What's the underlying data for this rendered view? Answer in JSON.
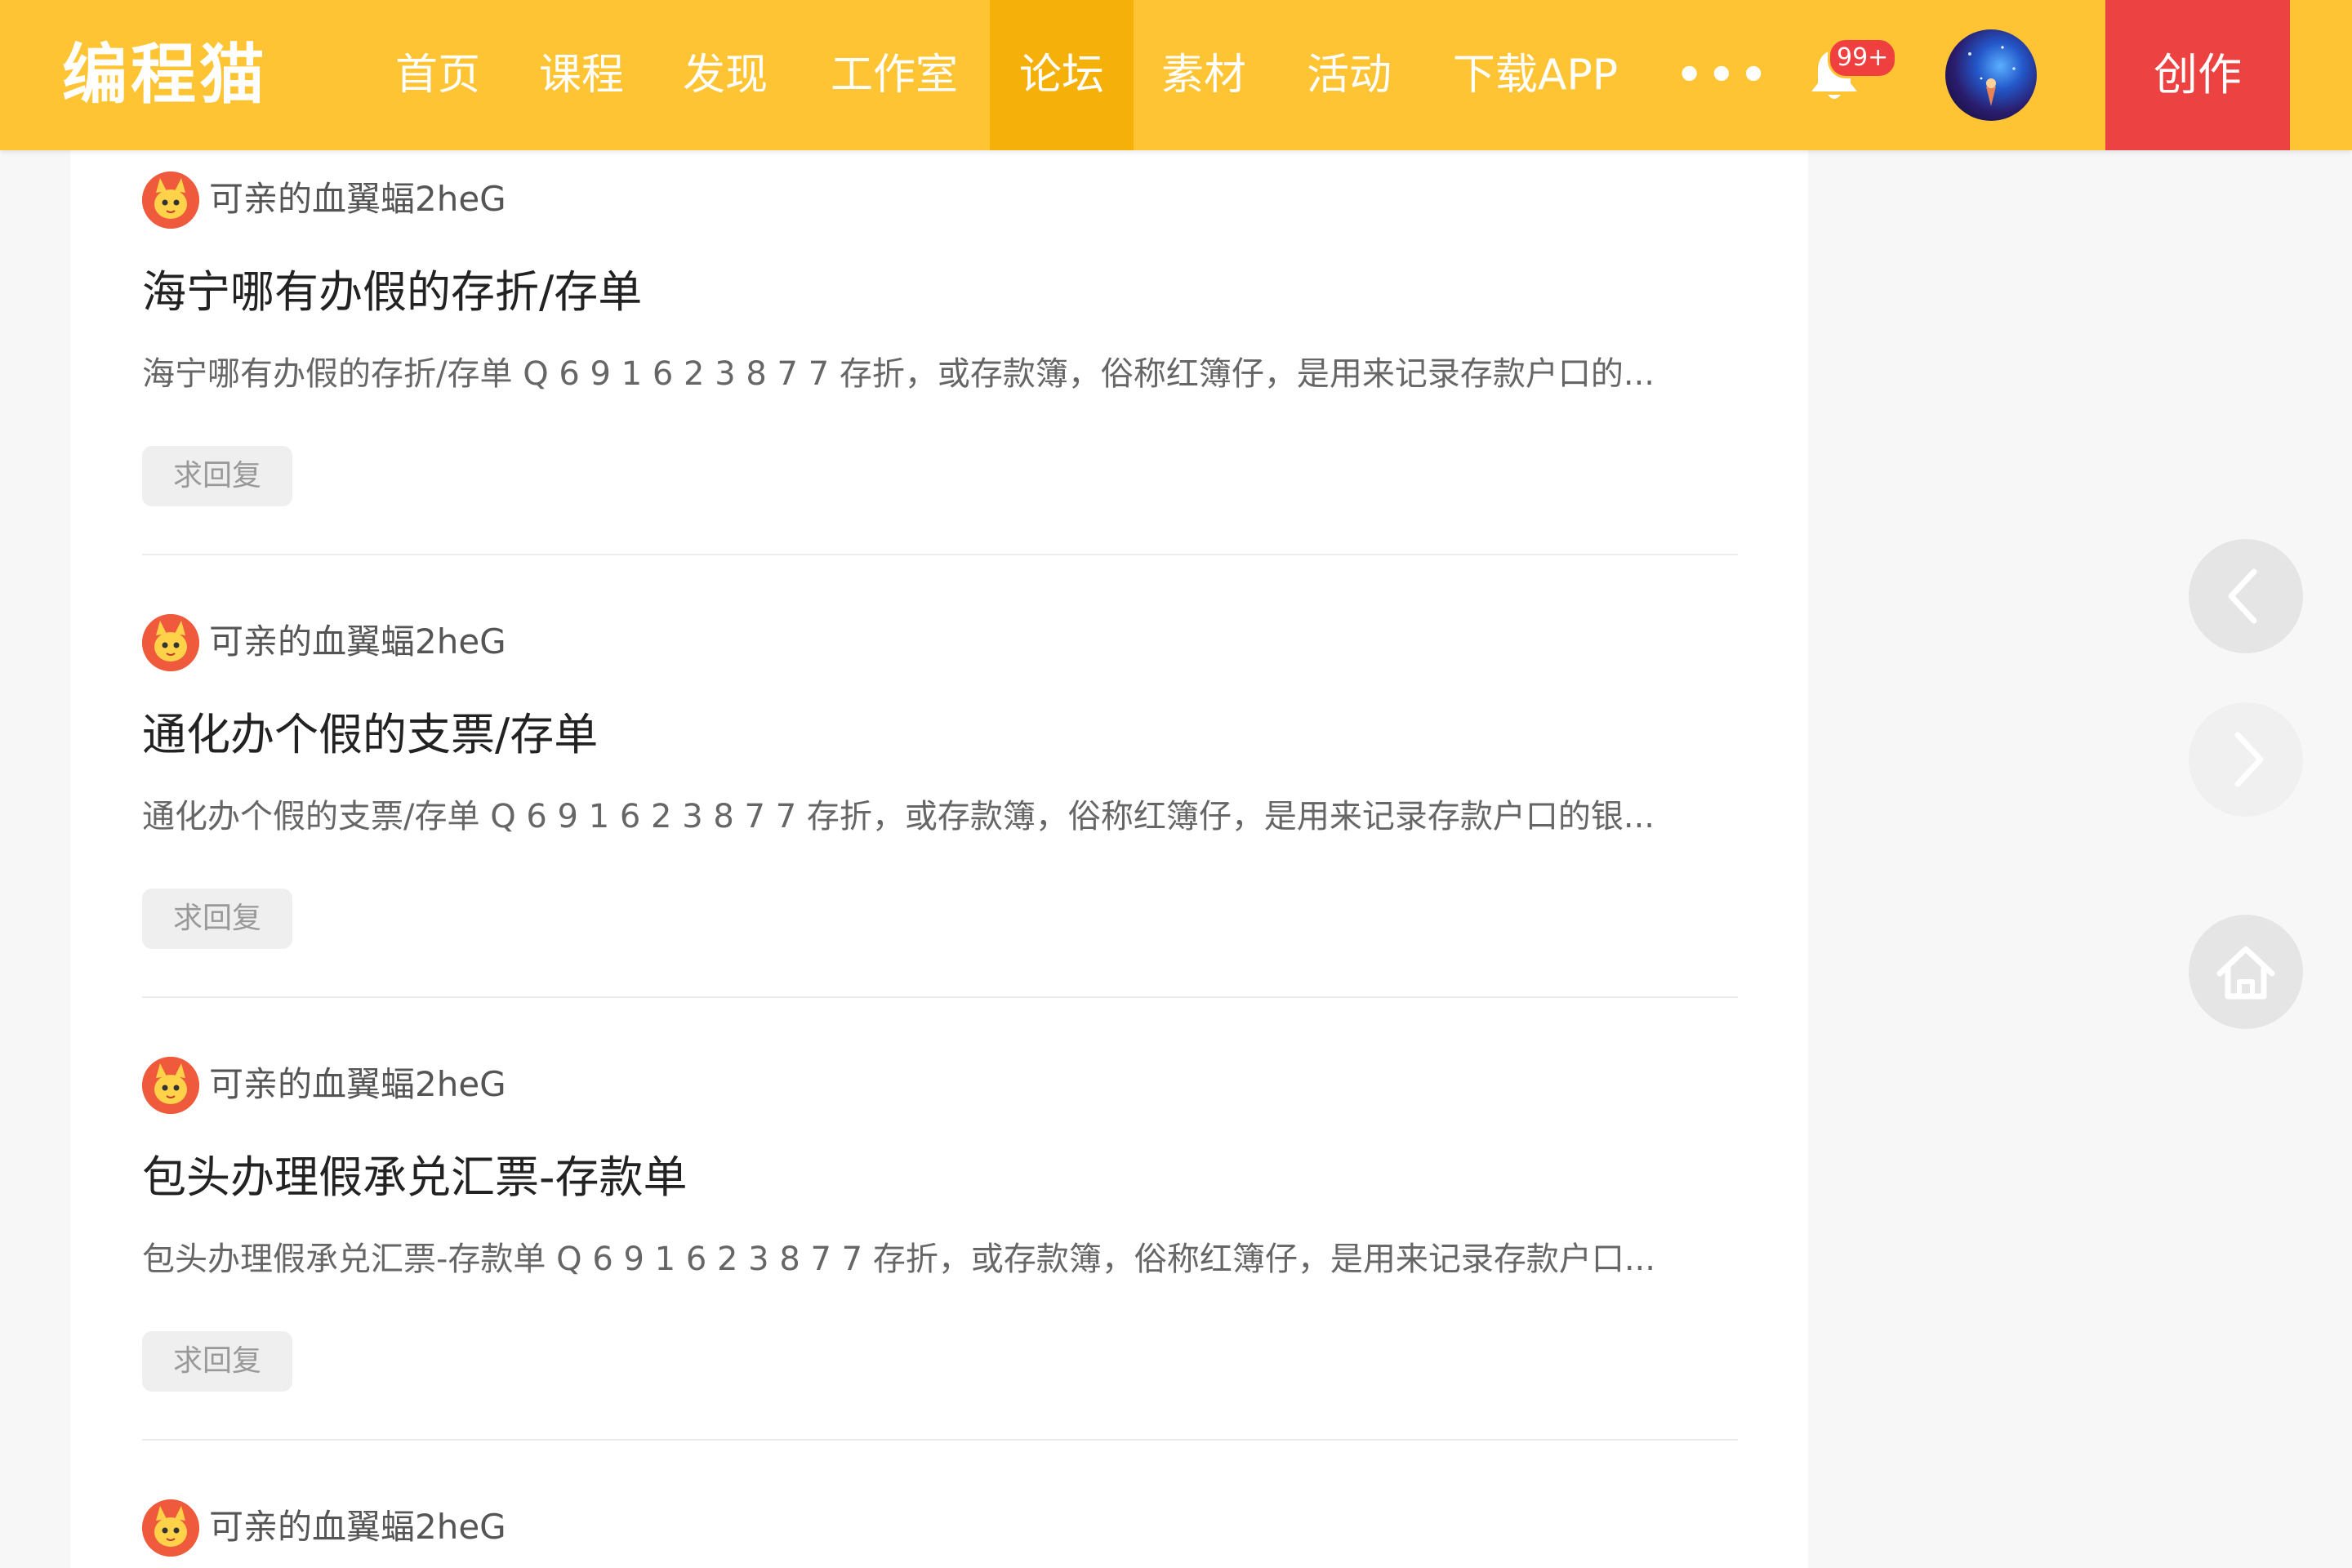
{
  "header": {
    "logo": "编程猫",
    "nav": [
      {
        "label": "首页"
      },
      {
        "label": "课程"
      },
      {
        "label": "发现"
      },
      {
        "label": "工作室"
      },
      {
        "label": "论坛",
        "active": true
      },
      {
        "label": "素材"
      },
      {
        "label": "活动"
      },
      {
        "label": "下载APP"
      }
    ],
    "more": "•••",
    "notification_badge": "99+",
    "create_label": "创作",
    "colors": {
      "bar": "#fec433",
      "active_tab": "#f5b10a",
      "create": "#ec4242"
    }
  },
  "posts": [
    {
      "author": "可亲的血翼蝠2heG",
      "title": "海宁哪有办假的存折/存单",
      "excerpt": "海宁哪有办假的存折/存单 Q 6 9 1 6 2 3 8 7 7 存折，或存款簿，俗称红簿仔，是用来记录存款户口的...",
      "tag": "求回复"
    },
    {
      "author": "可亲的血翼蝠2heG",
      "title": "通化办个假的支票/存单",
      "excerpt": "通化办个假的支票/存单 Q 6 9 1 6 2 3 8 7 7 存折，或存款簿，俗称红簿仔，是用来记录存款户口的银...",
      "tag": "求回复"
    },
    {
      "author": "可亲的血翼蝠2heG",
      "title": "包头办理假承兑汇票-存款单",
      "excerpt": "包头办理假承兑汇票-存款单 Q 6 9 1 6 2 3 8 7 7 存折，或存款簿，俗称红簿仔，是用来记录存款户口...",
      "tag": "求回复"
    },
    {
      "author": "可亲的血翼蝠2heG"
    }
  ],
  "side_buttons": [
    {
      "icon": "chevron-left-icon"
    },
    {
      "icon": "chevron-right-icon"
    },
    {
      "icon": "home-icon"
    }
  ]
}
